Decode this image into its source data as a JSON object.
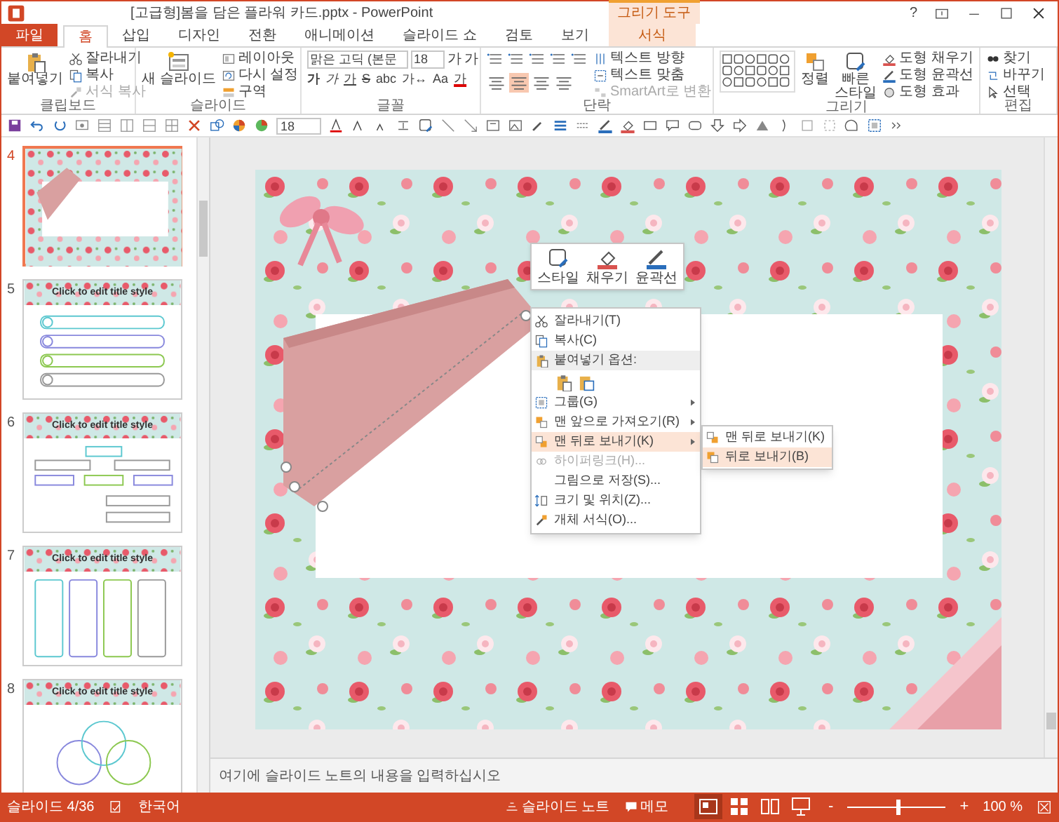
{
  "window": {
    "title": "[고급형]봄을 담은 플라워 카드.pptx - PowerPoint",
    "help": "?",
    "contextual_group": "그리기 도구"
  },
  "tabs": [
    {
      "label": "파일",
      "kind": "file",
      "selected": false
    },
    {
      "label": "홈",
      "kind": "normal",
      "selected": true
    },
    {
      "label": "삽입",
      "kind": "normal",
      "selected": false
    },
    {
      "label": "디자인",
      "kind": "normal",
      "selected": false
    },
    {
      "label": "전환",
      "kind": "normal",
      "selected": false
    },
    {
      "label": "애니메이션",
      "kind": "normal",
      "selected": false
    },
    {
      "label": "슬라이드 쇼",
      "kind": "normal",
      "selected": false
    },
    {
      "label": "검토",
      "kind": "normal",
      "selected": false
    },
    {
      "label": "보기",
      "kind": "normal",
      "selected": false
    },
    {
      "label": "서식",
      "kind": "contextual",
      "selected": false
    }
  ],
  "ribbon": {
    "groups": [
      {
        "kind": "clipboard",
        "label": "클립보드",
        "big": "붙여넣기",
        "items": [
          {
            "label": "잘라내기",
            "disabled": false
          },
          {
            "label": "복사",
            "disabled": false
          },
          {
            "label": "서식 복사",
            "disabled": true
          }
        ]
      },
      {
        "kind": "slides",
        "label": "슬라이드",
        "big": "새 슬라이드",
        "items": [
          {
            "label": "레이아웃",
            "disabled": false
          },
          {
            "label": "다시 설정",
            "disabled": false
          },
          {
            "label": "구역",
            "disabled": false
          }
        ]
      },
      {
        "kind": "font",
        "label": "글꼴",
        "font_name": "맑은 고딕 (본문",
        "font_size": "18",
        "size_buttons": [
          "가",
          "가"
        ],
        "format_buttons": [
          "가",
          "가",
          "가",
          "S",
          "abc",
          "가↔",
          "Aa",
          "가"
        ]
      },
      {
        "kind": "paragraph",
        "label": "단락",
        "align": [
          {
            "selected": false
          },
          {
            "selected": true
          },
          {
            "selected": false
          },
          {
            "selected": false
          }
        ],
        "items": [
          {
            "label": "텍스트 방향",
            "disabled": false
          },
          {
            "label": "텍스트 맞춤",
            "disabled": false
          },
          {
            "label": "SmartArt로 변환",
            "disabled": true
          }
        ]
      },
      {
        "kind": "drawing",
        "label": "그리기",
        "arrange": "정렬",
        "big": "빠른 스타일",
        "items": [
          {
            "label": "도형 채우기",
            "disabled": false
          },
          {
            "label": "도형 윤곽선",
            "disabled": false
          },
          {
            "label": "도형 효과",
            "disabled": false
          }
        ]
      },
      {
        "kind": "editing",
        "label": "편집",
        "items": [
          {
            "label": "찾기",
            "disabled": false
          },
          {
            "label": "바꾸기",
            "disabled": false
          },
          {
            "label": "선택",
            "disabled": false
          }
        ]
      }
    ]
  },
  "quick_access": {
    "font_size": "18"
  },
  "thumbnails": [
    {
      "number": "4",
      "kind": "cover",
      "selected": true
    },
    {
      "number": "5",
      "kind": "list",
      "title": "Click to edit title style",
      "selected": false
    },
    {
      "number": "6",
      "kind": "org",
      "title": "Click to edit title style",
      "selected": false
    },
    {
      "number": "7",
      "kind": "flow",
      "title": "Click to edit title style",
      "selected": false
    },
    {
      "number": "8",
      "kind": "venn",
      "title": "Click to edit title style",
      "selected": false
    }
  ],
  "mini_toolbar": [
    {
      "label": "스타일",
      "kind": "style"
    },
    {
      "label": "채우기",
      "kind": "fill"
    },
    {
      "label": "윤곽선",
      "kind": "outline"
    }
  ],
  "context_menu": [
    {
      "kind": "item",
      "label": "잘라내기(T)",
      "submenu": false,
      "selected": false,
      "disabled": false
    },
    {
      "kind": "item",
      "label": "복사(C)",
      "submenu": false,
      "selected": false,
      "disabled": false
    },
    {
      "kind": "header",
      "label": "붙여넣기 옵션:"
    },
    {
      "kind": "paste_options"
    },
    {
      "kind": "item",
      "label": "그룹(G)",
      "submenu": true,
      "selected": false,
      "disabled": false
    },
    {
      "kind": "item",
      "label": "맨 앞으로 가져오기(R)",
      "submenu": true,
      "selected": false,
      "disabled": false
    },
    {
      "kind": "item",
      "label": "맨 뒤로 보내기(K)",
      "submenu": true,
      "selected": true,
      "disabled": false
    },
    {
      "kind": "item",
      "label": "하이퍼링크(H)...",
      "submenu": false,
      "selected": false,
      "disabled": true
    },
    {
      "kind": "item",
      "label": "그림으로 저장(S)...",
      "submenu": false,
      "selected": false,
      "disabled": false
    },
    {
      "kind": "item",
      "label": "크기 및 위치(Z)...",
      "submenu": false,
      "selected": false,
      "disabled": false
    },
    {
      "kind": "item",
      "label": "개체 서식(O)...",
      "submenu": false,
      "selected": false,
      "disabled": false
    }
  ],
  "submenu": [
    {
      "label": "맨 뒤로 보내기(K)",
      "selected": false
    },
    {
      "label": "뒤로 보내기(B)",
      "selected": true
    }
  ],
  "notes": {
    "placeholder": "여기에 슬라이드 노트의 내용을 입력하십시오"
  },
  "status_bar": {
    "slide": "슬라이드 4/36",
    "language": "한국어",
    "notes": "슬라이드 노트",
    "comments": "메모",
    "views": [
      {
        "selected": true
      },
      {
        "selected": false
      },
      {
        "selected": false
      },
      {
        "selected": false
      }
    ],
    "zoom_out": "-",
    "zoom_in": "+",
    "zoom": {
      "level": 0.5
    },
    "zoom_text": "100 %"
  }
}
